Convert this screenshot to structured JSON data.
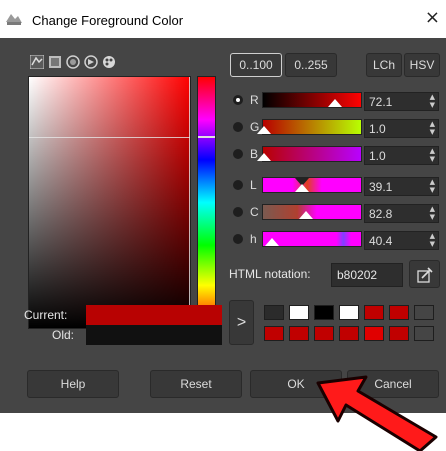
{
  "window": {
    "title": "Change Foreground Color",
    "close_icon": "close-icon"
  },
  "tabs": [
    "gimp-selector-icon",
    "scales-icon",
    "watercolor-icon",
    "triangle-icon",
    "palette-icon"
  ],
  "range_buttons": {
    "r0_100": "0..100",
    "r0_255": "0..255",
    "lch": "LCh",
    "hsv": "HSV",
    "active": "0..100"
  },
  "channels": [
    {
      "label": "R",
      "value": "72.1",
      "selected": true
    },
    {
      "label": "G",
      "value": "1.0",
      "selected": false
    },
    {
      "label": "B",
      "value": "1.0",
      "selected": false
    },
    {
      "label": "L",
      "value": "39.1",
      "selected": false
    },
    {
      "label": "C",
      "value": "82.8",
      "selected": false
    },
    {
      "label": "h",
      "value": "40.4",
      "selected": false
    }
  ],
  "html_notation": {
    "label": "HTML notation:",
    "value": "b80202",
    "eyedropper_icon": "eyedropper-icon"
  },
  "current_label": "Current:",
  "old_label": "Old:",
  "current_color": "#b80202",
  "old_color": "#111111",
  "history_arrow": ">",
  "history_colors": [
    [
      "#2b2b2b",
      "#ffffff",
      "#000000",
      "#ffffff",
      "#c00000",
      "#c00000"
    ],
    [
      "#c00000",
      "#c00000",
      "#c00000",
      "#c00000",
      "#e00000",
      "#c00000"
    ]
  ],
  "buttons": {
    "help": "Help",
    "reset": "Reset",
    "ok": "OK",
    "cancel": "Cancel"
  },
  "annotation": {
    "arrow_color": "#ff0000",
    "icon": "red-arrow-icon"
  }
}
